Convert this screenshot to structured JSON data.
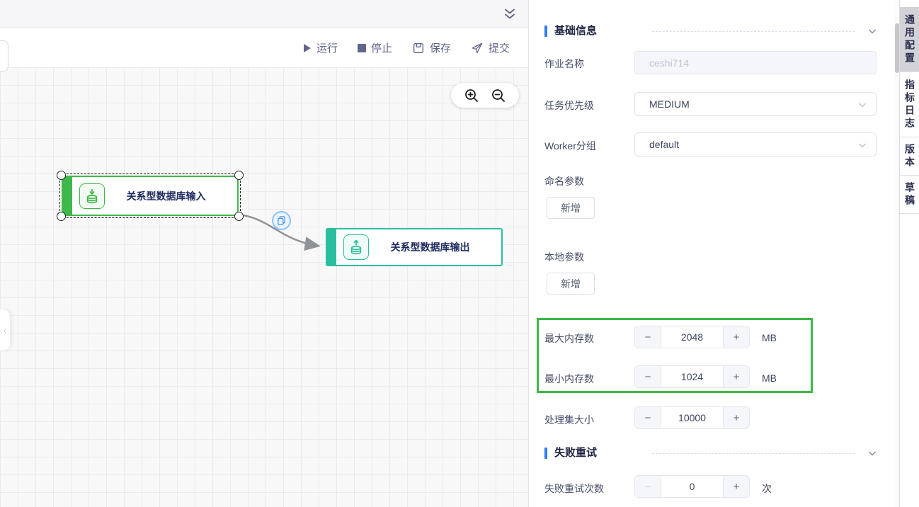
{
  "toolbar": {
    "run_label": "运行",
    "stop_label": "停止",
    "save_label": "保存",
    "submit_label": "提交"
  },
  "canvas": {
    "nodes": [
      {
        "label": "关系型数据库输入"
      },
      {
        "label": "关系型数据库输出"
      }
    ],
    "collapse_arrow": "‹"
  },
  "panel": {
    "basic_section_title": "基础信息",
    "retry_section_title": "失败重试",
    "job_name_label": "作业名称",
    "job_name_placeholder": "ceshi714",
    "priority_label": "任务优先级",
    "priority_value": "MEDIUM",
    "worker_group_label": "Worker分组",
    "worker_group_value": "default",
    "named_params_label": "命名参数",
    "named_params_add": "新增",
    "local_params_label": "本地参数",
    "local_params_add": "新增",
    "max_memory_label": "最大内存数",
    "max_memory_value": "2048",
    "max_memory_unit": "MB",
    "min_memory_label": "最小内存数",
    "min_memory_value": "1024",
    "min_memory_unit": "MB",
    "batch_size_label": "处理集大小",
    "batch_size_value": "10000",
    "retry_count_label": "失败重试次数",
    "retry_count_value": "0",
    "retry_count_unit": "次",
    "stepper_minus": "−",
    "stepper_plus": "+"
  },
  "side_tabs": [
    {
      "label": "通用配置",
      "active": true
    },
    {
      "label": "指标日志",
      "active": false
    },
    {
      "label": "版本",
      "active": false
    },
    {
      "label": "草稿",
      "active": false
    }
  ],
  "colors": {
    "node_input_green": "#3eb84a",
    "node_output_teal": "#2abf9e",
    "accent_blue": "#2e7cf6",
    "highlight_green": "#3eb845",
    "toolbar_icon": "#61658c"
  }
}
